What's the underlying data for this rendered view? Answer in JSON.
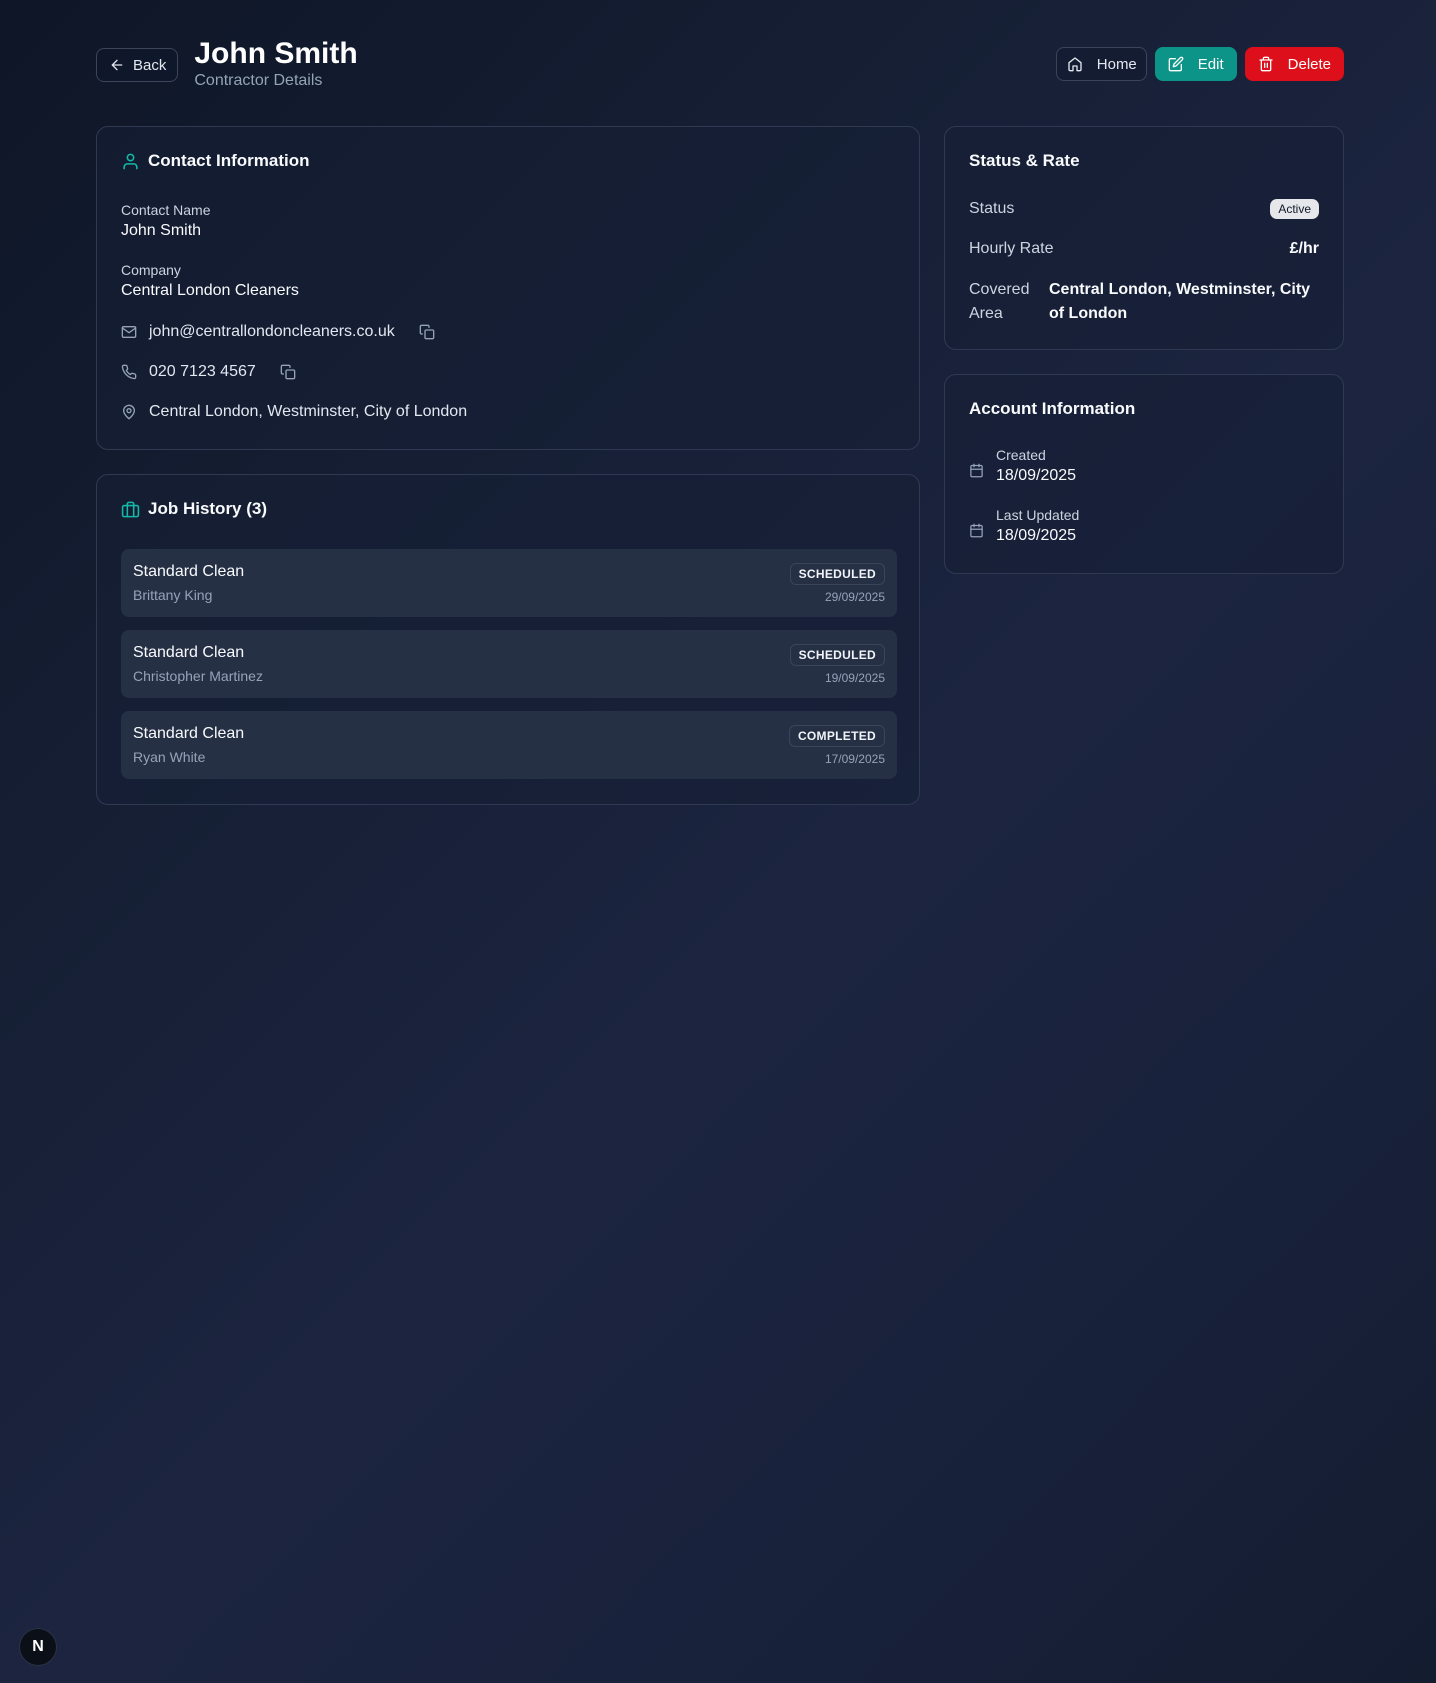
{
  "header": {
    "back_label": "Back",
    "title": "John Smith",
    "subtitle": "Contractor Details",
    "home_label": "Home",
    "edit_label": "Edit",
    "delete_label": "Delete"
  },
  "contact": {
    "title": "Contact Information",
    "contact_name_label": "Contact Name",
    "contact_name": "John Smith",
    "company_label": "Company",
    "company": "Central London Cleaners",
    "email": "john@centrallondoncleaners.co.uk",
    "phone": "020 7123 4567",
    "address": "Central London, Westminster, City of London"
  },
  "jobs": {
    "title": "Job History (3)",
    "items": [
      {
        "title": "Standard Clean",
        "client": "Brittany King",
        "status": "SCHEDULED",
        "date": "29/09/2025"
      },
      {
        "title": "Standard Clean",
        "client": "Christopher Martinez",
        "status": "SCHEDULED",
        "date": "19/09/2025"
      },
      {
        "title": "Standard Clean",
        "client": "Ryan White",
        "status": "COMPLETED",
        "date": "17/09/2025"
      }
    ]
  },
  "status_rate": {
    "title": "Status & Rate",
    "status_label": "Status",
    "status_value": "Active",
    "rate_label": "Hourly Rate",
    "rate_value": "£/hr",
    "area_label_1": "Covered",
    "area_label_2": "Area",
    "area_value": "Central London, Westminster, City of London"
  },
  "account": {
    "title": "Account Information",
    "created_label": "Created",
    "created_value": "18/09/2025",
    "updated_label": "Last Updated",
    "updated_value": "18/09/2025"
  },
  "devtools": {
    "badge": "N"
  },
  "colors": {
    "accent": "#0d9488",
    "danger": "#dc0f1a",
    "background": "#172036"
  }
}
